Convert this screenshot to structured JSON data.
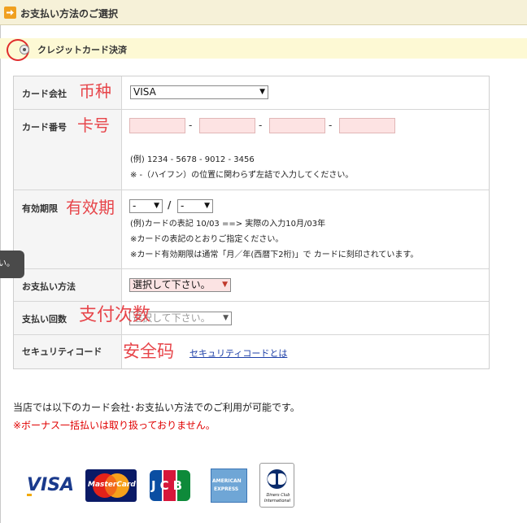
{
  "header": {
    "title": "お支払い方法のご選択"
  },
  "payment_method": {
    "label": "クレジットカード決済",
    "selected": true
  },
  "form": {
    "card_company": {
      "label": "カード会社",
      "annotation": "币种",
      "value": "VISA"
    },
    "card_number": {
      "label": "カード番号",
      "annotation": "卡号",
      "separator": "-",
      "example": "(例) 1234 - 5678 - 9012 - 3456",
      "note": "※ -（ハイフン）の位置に関わらず左詰で入力してください。"
    },
    "expiry": {
      "label": "有効期限",
      "annotation": "有效期",
      "month_value": "-",
      "year_value": "-",
      "separator": "/",
      "note1": "(例)カードの表記 10/03 ==> 実際の入力10月/03年",
      "note2": "※カードの表記のとおりご指定ください。",
      "note3": "※カード有効期限は通常「月／年(西暦下2桁)」で カードに刻印されています。"
    },
    "payment_type": {
      "label": "お支払い方法",
      "value": "選択して下さい。"
    },
    "installments": {
      "label": "支払い回数",
      "annotation": "支付次数",
      "value": "選択して下さい。"
    },
    "security_code": {
      "label": "セキュリティコード",
      "annotation": "安全码",
      "link": "セキュリティコードとは"
    }
  },
  "side_tab": {
    "text": "い。"
  },
  "info": {
    "accepted_text": "当店では以下のカード会社･お支払い方法でのご利用が可能です。",
    "warning_text": "※ボーナス一括払いは取り扱っておりません。"
  },
  "logos": {
    "visa": "VISA",
    "mastercard": "MasterCard",
    "jcb": "JCB",
    "amex_line1": "AMERICAN",
    "amex_line2": "EXPRESS",
    "diners_line1": "Diners Club",
    "diners_line2": "International"
  },
  "colors": {
    "header_bg": "#f6f1d8",
    "band_bg": "#fdf9d4",
    "annotation_red": "#e7454a",
    "warning_red": "#e00000",
    "field_pink": "#fde3e3",
    "link_blue": "#1d3fa8"
  }
}
